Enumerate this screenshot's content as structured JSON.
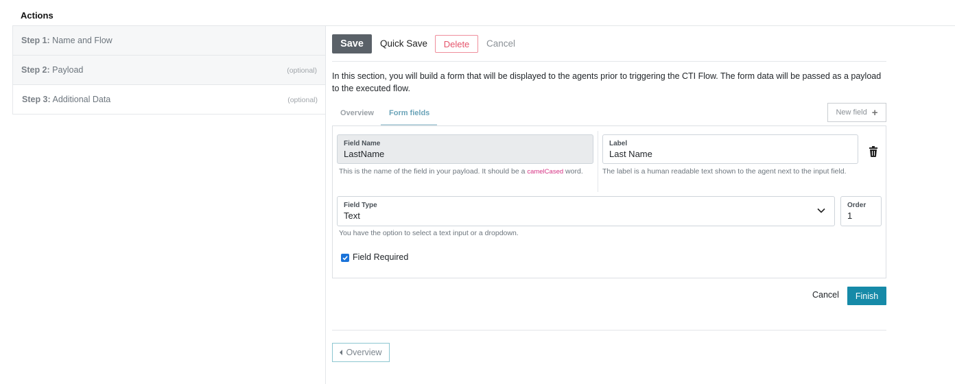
{
  "page": {
    "title": "Actions"
  },
  "steps": [
    {
      "number": "Step 1:",
      "label": "Name and Flow",
      "optional": ""
    },
    {
      "number": "Step 2:",
      "label": "Payload",
      "optional": "(optional)"
    },
    {
      "number": "Step 3:",
      "label": "Additional Data",
      "optional": "(optional)"
    }
  ],
  "toolbar": {
    "save": "Save",
    "quick_save": "Quick Save",
    "delete": "Delete",
    "cancel": "Cancel"
  },
  "intro": "In this section, you will build a form that will be displayed to the agents prior to triggering the CTI Flow. The form data will be passed as a payload to the executed flow.",
  "tabs": [
    {
      "label": "Overview",
      "active": false
    },
    {
      "label": "Form fields",
      "active": true
    }
  ],
  "new_field_button": "New field",
  "form": {
    "field_name": {
      "label": "Field Name",
      "value": "LastName",
      "help_before": "This is the name of the field in your payload. It should be a ",
      "help_code": "camelCased",
      "help_after": " word."
    },
    "field_label": {
      "label": "Label",
      "value": "Last Name",
      "help": "The label is a human readable text shown to the agent next to the input field."
    },
    "field_type": {
      "label": "Field Type",
      "value": "Text",
      "help": "You have the option to select a text input or a dropdown."
    },
    "order": {
      "label": "Order",
      "value": "1"
    },
    "required": {
      "label": "Field Required",
      "checked": true
    }
  },
  "footer": {
    "cancel": "Cancel",
    "finish": "Finish"
  },
  "nav": {
    "overview": "Overview"
  },
  "colors": {
    "accent": "#168aa8",
    "danger": "#e5536a",
    "checkbox": "#1a73d9",
    "save_bg": "#5a6168"
  }
}
